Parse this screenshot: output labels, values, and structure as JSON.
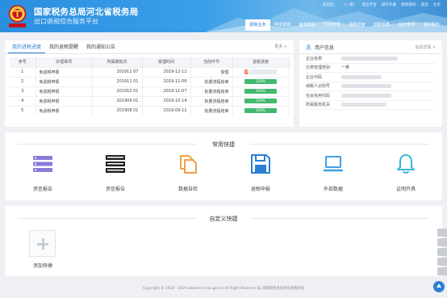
{
  "header": {
    "title": "国家税务总局河北省税务局",
    "subtitle": "出口退税综合服务平台",
    "top_links": [
      "欢迎您：",
      "（一类）",
      "退出平台",
      "操作手册",
      "修改密码",
      "退出",
      "主页"
    ],
    "nav": [
      "退税业务",
      "申报退税",
      "备案核验",
      "文书开具",
      "退税进度",
      "退税报表",
      "综合查询",
      "退税服务"
    ],
    "nav_active_index": 0
  },
  "notice": {
    "tabs": [
      "我的进税进度",
      "我的退税提醒",
      "我的通知公告"
    ],
    "active_tab": 0,
    "more": "更多 >",
    "columns": [
      "序号",
      "办理事项",
      "所属期批次",
      "受理时间",
      "当前环节",
      "退税进度"
    ],
    "rows": [
      {
        "no": "1",
        "item": "免退税申报",
        "period": "201911 07",
        "date": "2019-12-12",
        "stage": "受理",
        "progress": 10,
        "progress_text": "10%"
      },
      {
        "no": "2",
        "item": "免退税申报",
        "period": "201911 01",
        "date": "2019-12-06",
        "stage": "批量流程结束",
        "progress": 100,
        "progress_text": "100%"
      },
      {
        "no": "3",
        "item": "免退税申报",
        "period": "201910 01",
        "date": "2019-11-07",
        "stage": "批量流程结束",
        "progress": 100,
        "progress_text": "100%"
      },
      {
        "no": "4",
        "item": "免退税申报",
        "period": "201909 01",
        "date": "2019-10-14",
        "stage": "批量流程结束",
        "progress": 100,
        "progress_text": "100%"
      },
      {
        "no": "5",
        "item": "免退税申报",
        "period": "201908 01",
        "date": "2019-09-12",
        "stage": "批量流程结束",
        "progress": 100,
        "progress_text": "100%"
      }
    ]
  },
  "user_info": {
    "title": "用户信息",
    "detail": "信息详情 >",
    "rows": [
      {
        "key": "企业名称",
        "value": ""
      },
      {
        "key": "分类管理类别",
        "value": "一类"
      },
      {
        "key": "企业代码",
        "value": ""
      },
      {
        "key": "纳税人识别号",
        "value": ""
      },
      {
        "key": "社会信用代码",
        "value": ""
      },
      {
        "key": "所属税务机关",
        "value": ""
      }
    ]
  },
  "quick": {
    "title": "常用快捷",
    "items": [
      {
        "label": "资信报告",
        "icon": "report-stack-icon"
      },
      {
        "label": "资信报告",
        "icon": "list-stack-icon"
      },
      {
        "label": "数据自检",
        "icon": "documents-icon"
      },
      {
        "label": "退税申报",
        "icon": "save-disk-icon"
      },
      {
        "label": "外部数据",
        "icon": "laptop-icon"
      },
      {
        "label": "证明开具",
        "icon": "bell-icon"
      }
    ]
  },
  "custom": {
    "title": "自定义快捷",
    "add_label": "添加快捷"
  },
  "footer": {
    "text": "Copyright © 2018 - 2019 www.he-n-tax.gov.cn All Right Reserver By 国家税务总局河北省税务局"
  },
  "colors": {
    "brand_blue": "#2b7fd4",
    "progress_green": "#43b96e",
    "progress_orange": "#ef7b4a"
  }
}
